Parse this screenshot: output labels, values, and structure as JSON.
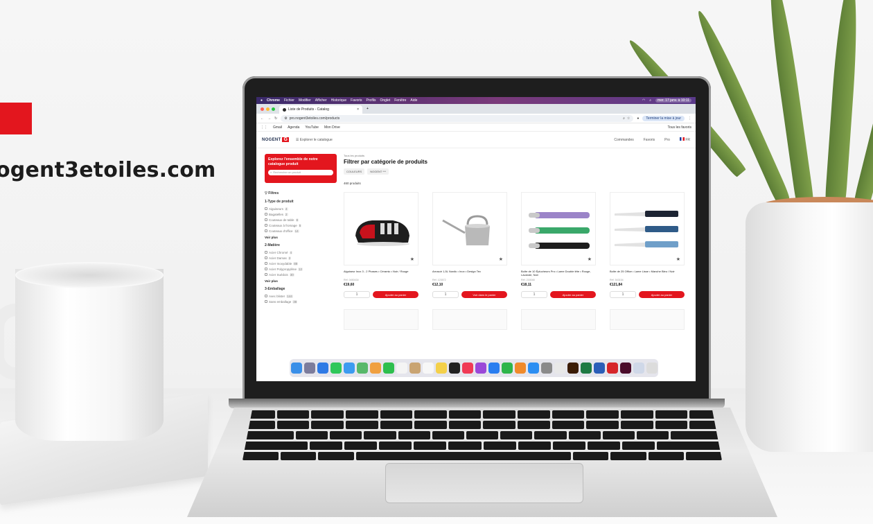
{
  "overlay": {
    "domain_text": "ogent3etoiles.com"
  },
  "menubar": {
    "items": [
      "Chrome",
      "Fichier",
      "Modifier",
      "Afficher",
      "Historique",
      "Favoris",
      "Profils",
      "Onglet",
      "Fenêtre",
      "Aide"
    ],
    "clock": "mer. 17 janv. à 10:11"
  },
  "browser": {
    "tab_title": "Liste de Produits - Catalog",
    "url": "pro.nogent3etoiles.com/products",
    "update_button": "Terminer la mise à jour",
    "bookmarks": [
      "Gmail",
      "Agenda",
      "YouTube",
      "Mon Drive"
    ],
    "all_bookmarks": "Tous les favoris"
  },
  "site": {
    "logo_word": "NOGENT",
    "logo_mark": "G",
    "catalog_link": "Explorer le catalogue",
    "header_right": [
      "Commandes",
      "Favoris",
      "Pro",
      "FR"
    ]
  },
  "sidebar": {
    "promo_title": "Explorez l'ensemble de notre catalogue produit",
    "search_placeholder": "Rechercher un produit",
    "filters_label": "Filtres",
    "groups": [
      {
        "title": "1-Type de produit",
        "options": [
          {
            "label": "Aiguiseurs",
            "count": "4"
          },
          {
            "label": "Bagatelles",
            "count": "2"
          },
          {
            "label": "Couteaux de table",
            "count": "8"
          },
          {
            "label": "Couteaux à fromage",
            "count": "5"
          },
          {
            "label": "Couteaux d'office",
            "count": "14"
          }
        ],
        "more": "Voir plus"
      },
      {
        "title": "2-Matière",
        "options": [
          {
            "label": "Acier Chromé",
            "count": "4"
          },
          {
            "label": "Acier Damas",
            "count": "2"
          },
          {
            "label": "Acier Inoxydable",
            "count": "88"
          },
          {
            "label": "Acier Polypropylène",
            "count": "12"
          },
          {
            "label": "Acier Suédois",
            "count": "30"
          }
        ],
        "more": "Voir plus"
      },
      {
        "title": "3-Emballage",
        "options": [
          {
            "label": "Avec blister",
            "count": "144"
          },
          {
            "label": "Sans emballage",
            "count": "38"
          }
        ]
      }
    ]
  },
  "main": {
    "breadcrumb": "Tous les produits",
    "title": "Filtrer par catégorie de produits",
    "chips": [
      "COULEURS",
      "NOGENT ***"
    ],
    "result_count": "460 produits",
    "products": [
      {
        "name": "Aiguiseur Inox 3 - 2 Phases • Céramic • Noir / Rouge",
        "ref": "Réf. 0450434",
        "price": "€19,60",
        "button": "Ajouter au panier"
      },
      {
        "name": "Arrosoir 1,5L Nordic • Inox • Design Tec",
        "ref": "Réf. 123572",
        "price": "€12,10",
        "button": "Voir dans le panier"
      },
      {
        "name": "Boîte de 10 Éplucheurs Pro • Lame Double tête • Rouge, Lavande, Noir",
        "ref": "Réf. 215048",
        "price": "€18,11",
        "button": "Ajouter au panier"
      },
      {
        "name": "Boîte de 25 Office • Lame Lisse • Manche Bleu / Noir",
        "ref": "Réf. 543154",
        "price": "€121,84",
        "button": "Ajouter au panier"
      }
    ]
  }
}
